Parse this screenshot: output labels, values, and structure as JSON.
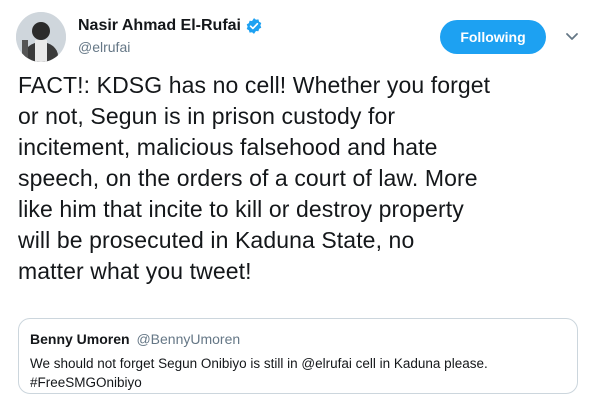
{
  "author": {
    "display_name": "Nasir Ahmad El-Rufai",
    "handle": "@elrufai",
    "verified": true,
    "avatar_icon": "profile-photo"
  },
  "follow_button": {
    "label": "Following",
    "color": "#1da1f2"
  },
  "menu": {
    "icon": "chevron-down-icon"
  },
  "tweet": {
    "lines": [
      "FACT!: KDSG has no cell! Whether you forget",
      "or not, Segun is in prison custody for",
      "incitement, malicious falsehood and hate",
      "speech, on the orders of a court of law. More",
      "like him that incite to kill or destroy property",
      "will be prosecuted in Kaduna State, no",
      "matter what you tweet!"
    ]
  },
  "quoted_tweet": {
    "display_name": "Benny Umoren",
    "handle": "@BennyUmoren",
    "lines": [
      "We should not forget Segun Onibiyo is still in @elrufai cell in Kaduna please.",
      "#FreeSMGOnibiyo"
    ]
  },
  "colors": {
    "text": "#14171a",
    "secondary": "#657786",
    "border": "#ccd6dd",
    "verified": "#1da1f2"
  }
}
